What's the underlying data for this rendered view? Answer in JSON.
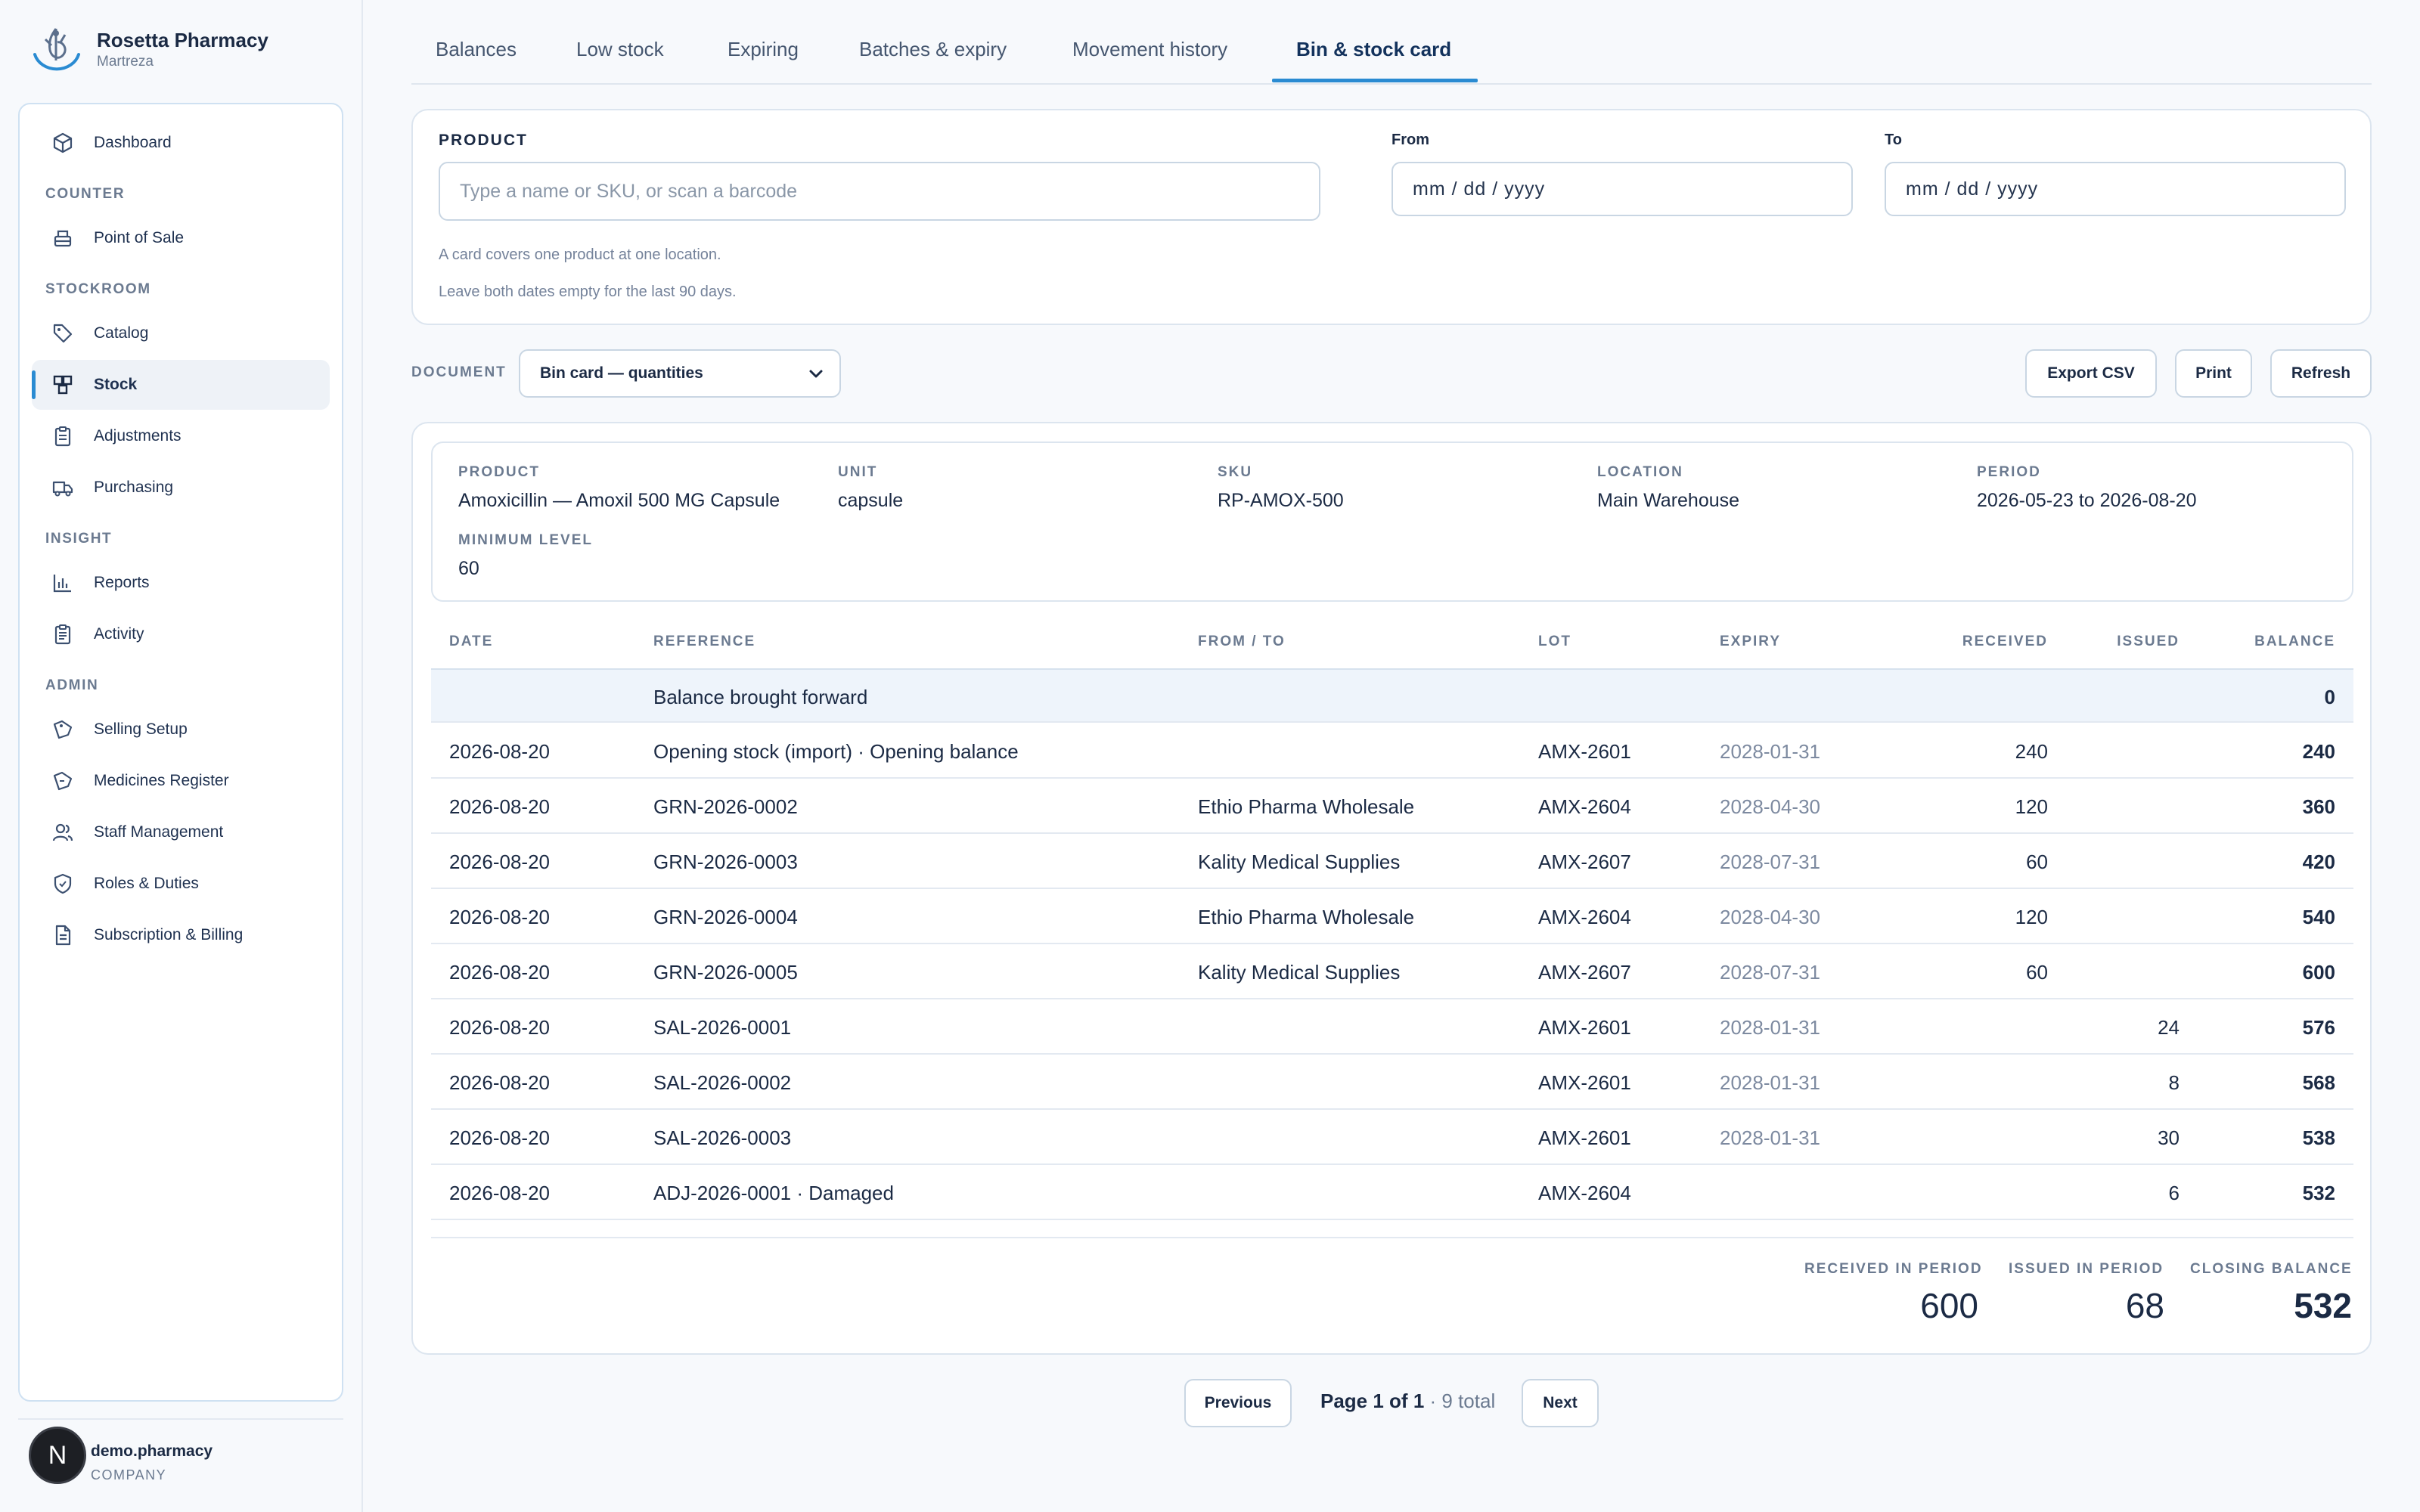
{
  "app": {
    "name": "Rosetta Pharmacy",
    "subtitle": "Martreza"
  },
  "sidebar": {
    "items": [
      {
        "label": "Dashboard",
        "icon": "cube-icon"
      },
      {
        "label": "Point of Sale",
        "icon": "register-icon"
      },
      {
        "label": "Catalog",
        "icon": "tag-icon"
      },
      {
        "label": "Stock",
        "icon": "boxes-icon",
        "active": true
      },
      {
        "label": "Adjustments",
        "icon": "clipboard-icon"
      },
      {
        "label": "Purchasing",
        "icon": "truck-icon"
      },
      {
        "label": "Reports",
        "icon": "bar-chart-icon"
      },
      {
        "label": "Activity",
        "icon": "clipboard-list-icon"
      },
      {
        "label": "Selling Setup",
        "icon": "price-tag-icon"
      },
      {
        "label": "Medicines Register",
        "icon": "pill-tag-icon"
      },
      {
        "label": "Staff Management",
        "icon": "users-icon"
      },
      {
        "label": "Roles & Duties",
        "icon": "shield-icon"
      },
      {
        "label": "Subscription & Billing",
        "icon": "document-icon"
      }
    ],
    "sections": [
      "COUNTER",
      "STOCKROOM",
      "INSIGHT",
      "ADMIN"
    ],
    "user": {
      "initial": "N",
      "name": "demo.pharmacy",
      "role": "COMPANY"
    }
  },
  "tabs": [
    "Balances",
    "Low stock",
    "Expiring",
    "Batches & expiry",
    "Movement history",
    "Bin & stock card"
  ],
  "active_tab": "Bin & stock card",
  "filter": {
    "product_label": "PRODUCT",
    "product_placeholder": "Type a name or SKU, or scan a barcode",
    "from_label": "From",
    "from_value": "mm / dd / yyyy",
    "to_label": "To",
    "to_value": "mm / dd / yyyy",
    "hint1": "A card covers one product at one location.",
    "hint2": "Leave both dates empty for the last 90 days."
  },
  "toolbar": {
    "document_label": "DOCUMENT",
    "document_value": "Bin card — quantities",
    "export": "Export CSV",
    "print": "Print",
    "refresh": "Refresh"
  },
  "card_info": {
    "product_label": "PRODUCT",
    "product": "Amoxicillin — Amoxil 500 MG Capsule",
    "unit_label": "UNIT",
    "unit": "capsule",
    "sku_label": "SKU",
    "sku": "RP-AMOX-500",
    "location_label": "LOCATION",
    "location": "Main Warehouse",
    "period_label": "PERIOD",
    "period": "2026-05-23 to 2026-08-20",
    "min_label": "MINIMUM LEVEL",
    "min": "60"
  },
  "table": {
    "headers": {
      "date": "DATE",
      "reference": "REFERENCE",
      "from_to": "FROM / TO",
      "lot": "LOT",
      "expiry": "EXPIRY",
      "received": "RECEIVED",
      "issued": "ISSUED",
      "balance": "BALANCE"
    },
    "brought_forward": {
      "label": "Balance brought forward",
      "balance": "0"
    },
    "rows": [
      {
        "date": "2026-08-20",
        "ref": "Opening stock (import) · Opening balance",
        "party": "",
        "lot": "AMX-2601",
        "expiry": "2028-01-31",
        "received": "240",
        "issued": "",
        "balance": "240"
      },
      {
        "date": "2026-08-20",
        "ref": "GRN-2026-0002",
        "party": "Ethio Pharma Wholesale",
        "lot": "AMX-2604",
        "expiry": "2028-04-30",
        "received": "120",
        "issued": "",
        "balance": "360"
      },
      {
        "date": "2026-08-20",
        "ref": "GRN-2026-0003",
        "party": "Kality Medical Supplies",
        "lot": "AMX-2607",
        "expiry": "2028-07-31",
        "received": "60",
        "issued": "",
        "balance": "420"
      },
      {
        "date": "2026-08-20",
        "ref": "GRN-2026-0004",
        "party": "Ethio Pharma Wholesale",
        "lot": "AMX-2604",
        "expiry": "2028-04-30",
        "received": "120",
        "issued": "",
        "balance": "540"
      },
      {
        "date": "2026-08-20",
        "ref": "GRN-2026-0005",
        "party": "Kality Medical Supplies",
        "lot": "AMX-2607",
        "expiry": "2028-07-31",
        "received": "60",
        "issued": "",
        "balance": "600"
      },
      {
        "date": "2026-08-20",
        "ref": "SAL-2026-0001",
        "party": "",
        "lot": "AMX-2601",
        "expiry": "2028-01-31",
        "received": "",
        "issued": "24",
        "balance": "576"
      },
      {
        "date": "2026-08-20",
        "ref": "SAL-2026-0002",
        "party": "",
        "lot": "AMX-2601",
        "expiry": "2028-01-31",
        "received": "",
        "issued": "8",
        "balance": "568"
      },
      {
        "date": "2026-08-20",
        "ref": "SAL-2026-0003",
        "party": "",
        "lot": "AMX-2601",
        "expiry": "2028-01-31",
        "received": "",
        "issued": "30",
        "balance": "538"
      },
      {
        "date": "2026-08-20",
        "ref": "ADJ-2026-0001 · Damaged",
        "party": "",
        "lot": "AMX-2604",
        "expiry": "",
        "received": "",
        "issued": "6",
        "balance": "532"
      }
    ]
  },
  "summary": {
    "received_label": "RECEIVED IN PERIOD",
    "received": "600",
    "issued_label": "ISSUED IN PERIOD",
    "issued": "68",
    "closing_label": "CLOSING BALANCE",
    "closing": "532"
  },
  "pager": {
    "prev": "Previous",
    "page_text": "Page 1 of 1",
    "total_text": "· 9 total",
    "next": "Next"
  },
  "colors": {
    "accent": "#2a8bd2",
    "text": "#1b2a44",
    "muted": "#6b7a90",
    "border": "#dce5ef"
  }
}
